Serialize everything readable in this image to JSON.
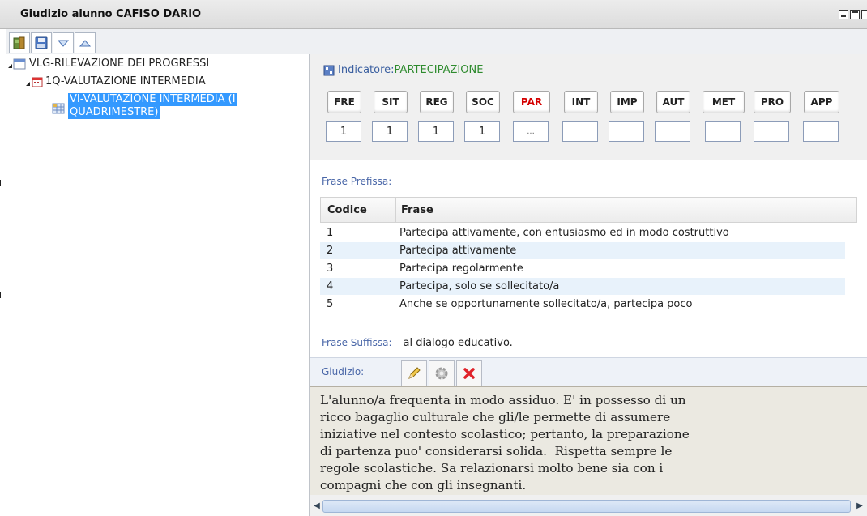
{
  "window": {
    "title": "Giudizio alunno CAFISO DARIO"
  },
  "toolbar": {
    "icons": [
      "exit-icon",
      "save-icon",
      "expand-down-icon",
      "collapse-up-icon"
    ]
  },
  "tree": {
    "root": "VLG-RILEVAZIONE DEI PROGRESSI",
    "child": "1Q-VALUTAZIONE INTERMEDIA",
    "leaf_line1": "VI-VALUTAZIONE INTERMEDIA (I",
    "leaf_line2": "QUADRIMESTRE)"
  },
  "indicatore": {
    "label": "Indicatore:",
    "value": "PARTECIPAZIONE"
  },
  "codes": [
    {
      "code": "FRE",
      "value": "1",
      "active": false
    },
    {
      "code": "SIT",
      "value": "1",
      "active": false
    },
    {
      "code": "REG",
      "value": "1",
      "active": false
    },
    {
      "code": "SOC",
      "value": "1",
      "active": false
    },
    {
      "code": "PAR",
      "value": "...",
      "active": true
    },
    {
      "code": "INT",
      "value": "",
      "active": false
    },
    {
      "code": "IMP",
      "value": "",
      "active": false
    },
    {
      "code": "AUT",
      "value": "",
      "active": false
    },
    {
      "code": "MET",
      "value": "",
      "active": false
    },
    {
      "code": "PRO",
      "value": "",
      "active": false
    },
    {
      "code": "APP",
      "value": "",
      "active": false
    }
  ],
  "frase_prefissa": {
    "label": "Frase Prefissa:",
    "columns": [
      "Codice",
      "Frase"
    ],
    "rows": [
      {
        "codice": "1",
        "frase": "Partecipa attivamente, con entusiasmo ed in modo costruttivo"
      },
      {
        "codice": "2",
        "frase": "Partecipa attivamente"
      },
      {
        "codice": "3",
        "frase": "Partecipa regolarmente"
      },
      {
        "codice": "4",
        "frase": "Partecipa, solo se sollecitato/a"
      },
      {
        "codice": "5",
        "frase": "Anche se opportunamente sollecitato/a, partecipa poco"
      }
    ]
  },
  "frase_suffissa": {
    "label": "Frase Suffissa:",
    "value": "al dialogo educativo."
  },
  "giudizio": {
    "label": "Giudizio:",
    "text": "L'alunno/a frequenta in modo assiduo. E' in possesso di un\nricco bagaglio culturale che gli/le permette di assumere\niniziative nel contesto scolastico; pertanto, la preparazione\ndi partenza puo' considerarsi solida.  Rispetta sempre le\nregole scolastiche. Sa relazionarsi molto bene sia con i\ncompagni che con gli insegnanti."
  },
  "colors": {
    "active_code": "#d40000",
    "selection": "#3399ff",
    "indicator_value": "#2e8b2e"
  }
}
